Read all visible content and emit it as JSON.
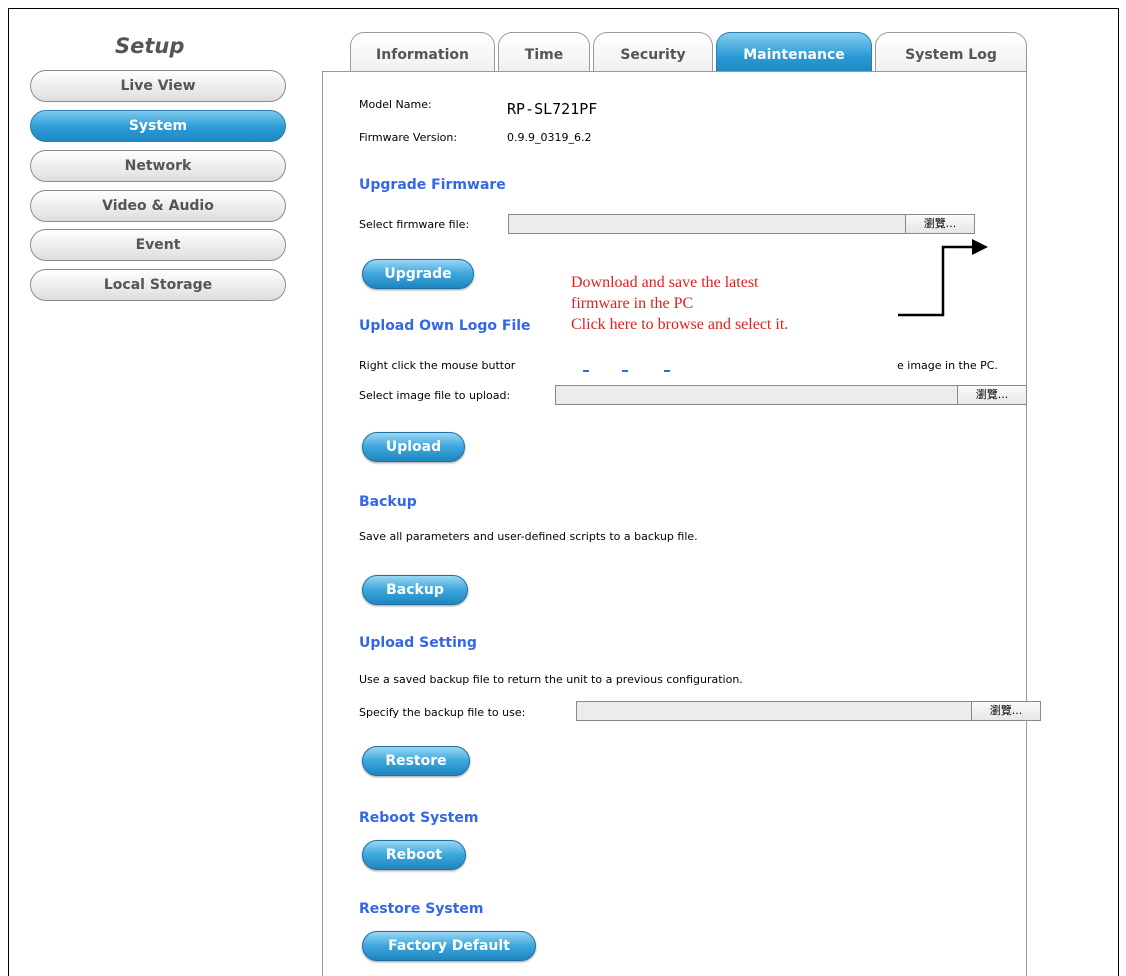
{
  "sidebar": {
    "title": "Setup",
    "items": [
      {
        "label": "Live View"
      },
      {
        "label": "System"
      },
      {
        "label": "Network"
      },
      {
        "label": "Video & Audio"
      },
      {
        "label": "Event"
      },
      {
        "label": "Local Storage"
      }
    ],
    "active_index": 1
  },
  "tabs": [
    {
      "label": "Information"
    },
    {
      "label": "Time"
    },
    {
      "label": "Security"
    },
    {
      "label": "Maintenance"
    },
    {
      "label": "System Log"
    }
  ],
  "active_tab": "Maintenance",
  "info": {
    "model_label": "Model Name:",
    "model_value": "RP-SL721PF",
    "firmware_label": "Firmware Version:",
    "firmware_value": "0.9.9_0319_6.2"
  },
  "upgrade": {
    "heading": "Upgrade Firmware",
    "field_label": "Select firmware file:",
    "browse_label": "瀏覽...",
    "button": "Upgrade"
  },
  "logo": {
    "heading": "Upload Own Logo File",
    "hint_left": "Right click the mouse buttor",
    "hint_right": "e image in the PC.",
    "field_label": "Select image file to upload:",
    "browse_label": "瀏覽...",
    "button": "Upload"
  },
  "backup": {
    "heading": "Backup",
    "description": "Save all parameters and user-defined scripts to a backup file.",
    "button": "Backup"
  },
  "upload_setting": {
    "heading": "Upload Setting",
    "description": "Use a saved backup file to return the unit to a previous configuration.",
    "field_label": "Specify the backup file to use:",
    "browse_label": "瀏覽...",
    "button": "Restore"
  },
  "reboot": {
    "heading": "Reboot System",
    "button": "Reboot"
  },
  "restore_system": {
    "heading": "Restore System",
    "button": "Factory Default"
  },
  "annotation": {
    "line1": "Download and save the latest",
    "line2": "firmware in the PC",
    "line3": "Click here to browse and select it.",
    "color": "#e02020"
  },
  "colors": {
    "accent": "#2a9bd6",
    "heading": "#3366e8"
  }
}
